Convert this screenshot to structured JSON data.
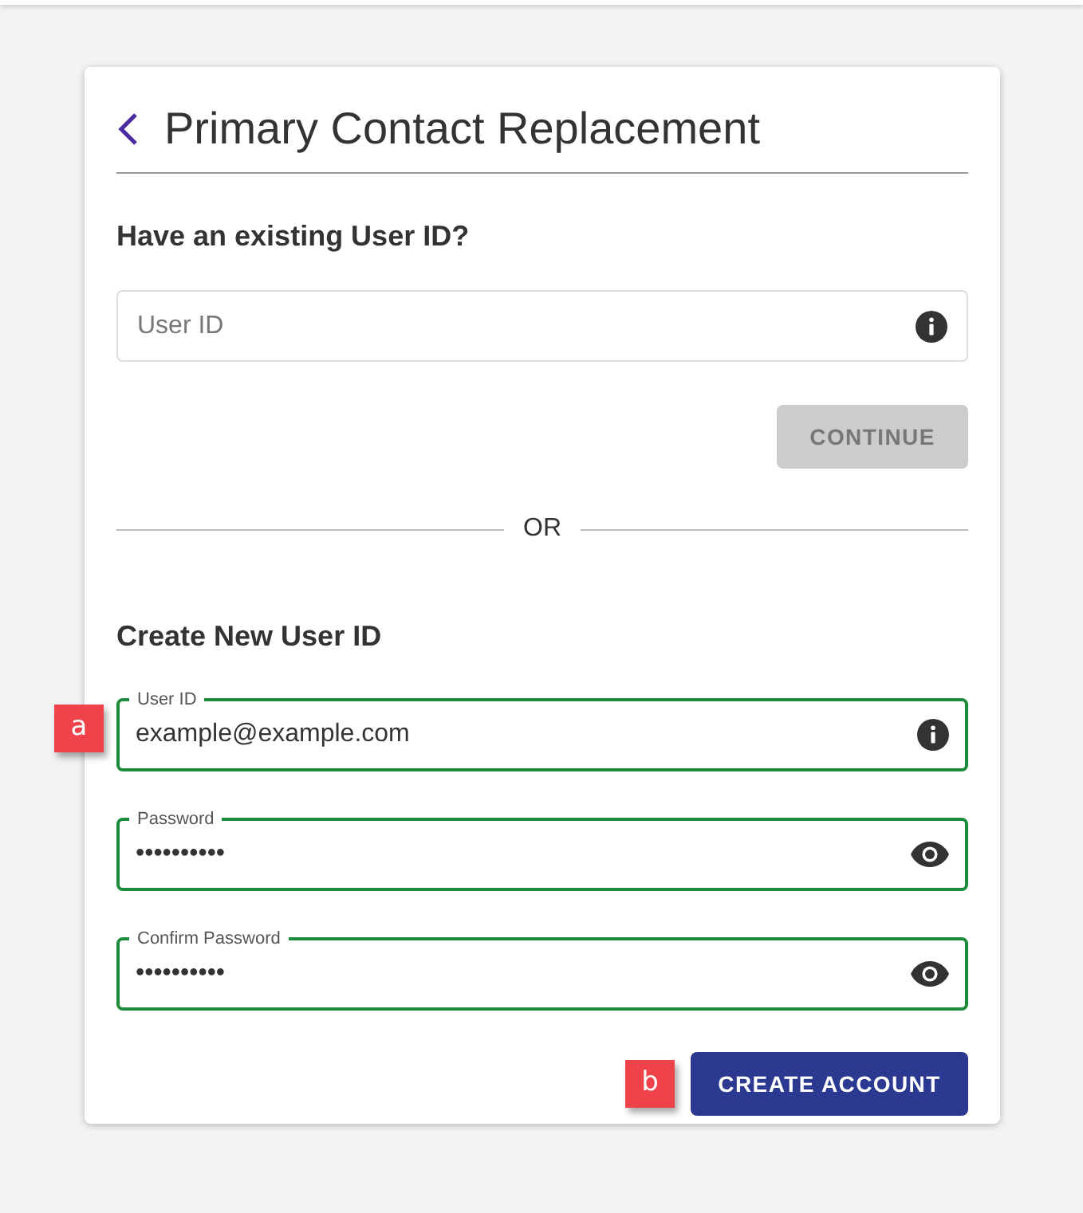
{
  "title": "Primary Contact Replacement",
  "existing": {
    "heading": "Have an existing User ID?",
    "field": {
      "placeholder": "User ID",
      "kind": "text"
    },
    "button": {
      "label": "CONTINUE",
      "disabled": true
    }
  },
  "separator": "OR",
  "create": {
    "heading": "Create New User ID",
    "fields": [
      {
        "label": "User ID",
        "value": "example@example.com",
        "kind": "text",
        "valid": true
      },
      {
        "label": "Password",
        "value": "••••••••••",
        "kind": "password",
        "valid": true
      },
      {
        "label": "Confirm Password",
        "value": "••••••••••",
        "kind": "password",
        "valid": true
      }
    ],
    "button": {
      "label": "CREATE ACCOUNT",
      "disabled": false
    }
  },
  "callouts": [
    {
      "label": "a"
    },
    {
      "label": "b"
    }
  ]
}
